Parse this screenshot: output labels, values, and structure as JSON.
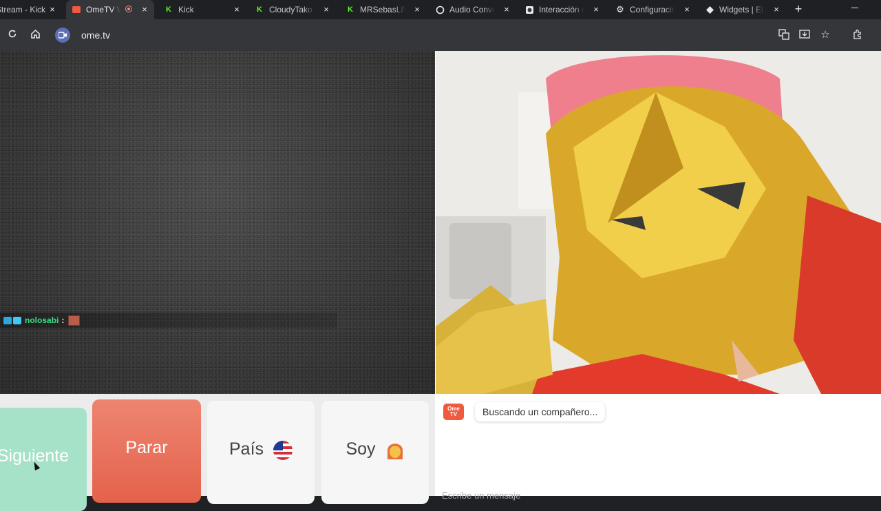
{
  "tabs": [
    {
      "title": "Stream - Kick",
      "close": "×",
      "fav": "",
      "active": false
    },
    {
      "title": "OmeTV V",
      "close": "×",
      "fav": "",
      "active": true
    },
    {
      "title": "Kick",
      "close": "×",
      "fav": "K",
      "active": false
    },
    {
      "title": "CloudyTako S",
      "close": "×",
      "fav": "K",
      "active": false
    },
    {
      "title": "MRSebasLIVE",
      "close": "×",
      "fav": "K",
      "active": false
    },
    {
      "title": "Audio Conve",
      "close": "×",
      "fav": "",
      "active": false
    },
    {
      "title": "Interacción c",
      "close": "×",
      "fav": "",
      "active": false
    },
    {
      "title": "Configuració",
      "close": "×",
      "fav": "",
      "active": false
    },
    {
      "title": "Widgets | El",
      "close": "×",
      "fav": "",
      "active": false
    }
  ],
  "new_tab": "+",
  "address": {
    "url": "ome.tv"
  },
  "chat_overlay": {
    "user": "nolosabi",
    "separator": ":"
  },
  "controls": {
    "next": "Siguiente",
    "stop": "Parar",
    "country": "País",
    "me": "Soy"
  },
  "chat": {
    "logo": "Ome TV",
    "status": "Buscando un compañero...",
    "input_placeholder": "Escribe un mensaje"
  },
  "colors": {
    "next_button": "#a6e2c8",
    "stop_button": "#e4624c",
    "username": "#3ddc84",
    "logo": "#f05a3e"
  }
}
